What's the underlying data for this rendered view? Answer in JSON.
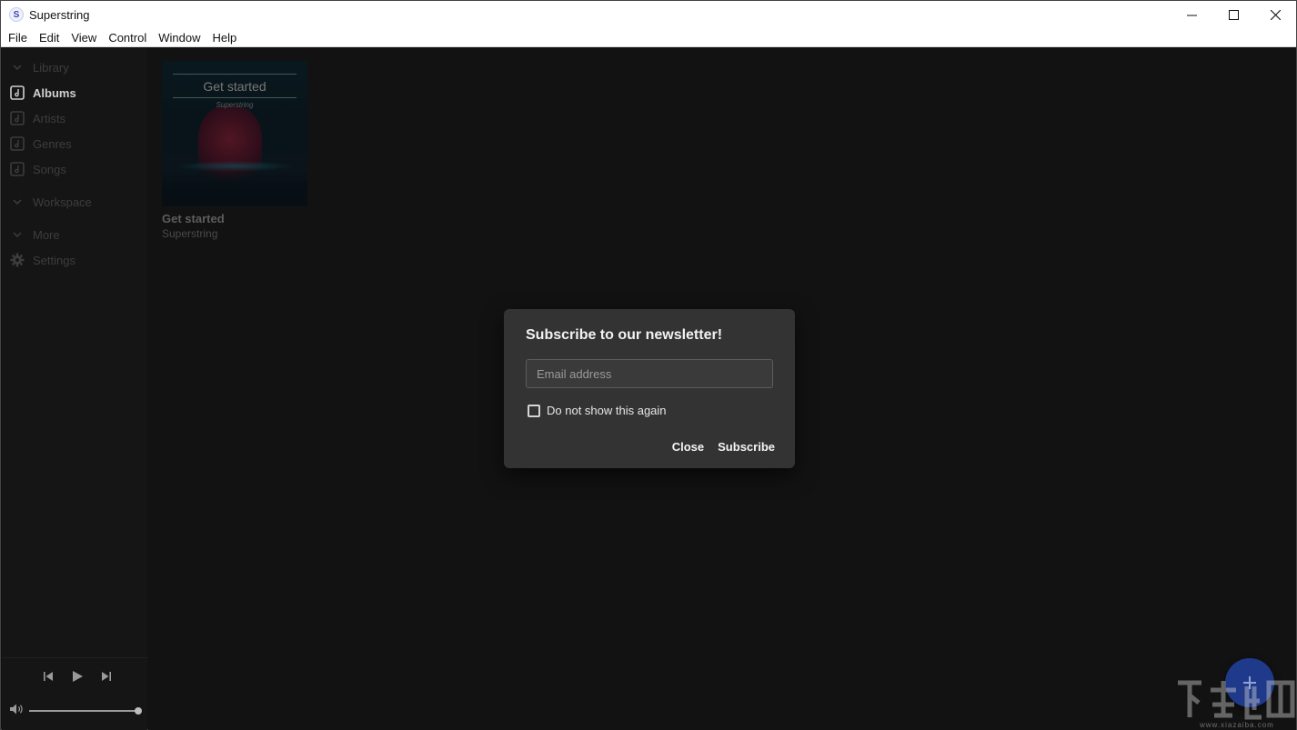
{
  "window": {
    "title": "Superstring",
    "app_icon_letter": "S"
  },
  "menu": {
    "items": [
      "File",
      "Edit",
      "View",
      "Control",
      "Window",
      "Help"
    ]
  },
  "sidebar": {
    "sections": {
      "library": "Library",
      "workspace": "Workspace",
      "more": "More"
    },
    "items": {
      "albums": "Albums",
      "artists": "Artists",
      "genres": "Genres",
      "songs": "Songs",
      "settings": "Settings"
    },
    "active": "albums",
    "volume_level": 1.0
  },
  "main": {
    "albums": [
      {
        "title": "Get started",
        "artist": "Superstring",
        "art_title": "Get started",
        "art_subtitle": "Superstring"
      }
    ]
  },
  "dialog": {
    "title": "Subscribe to our newsletter!",
    "email_placeholder": "Email address",
    "checkbox_label": "Do not show this again",
    "checkbox_checked": false,
    "close_label": "Close",
    "subscribe_label": "Subscribe"
  },
  "watermark": {
    "text": "www.xiazaiba.com"
  },
  "colors": {
    "dialog_bg": "#333333",
    "fab": "#1f3a8a",
    "sidebar_bg": "#151515",
    "main_bg": "#121212"
  }
}
